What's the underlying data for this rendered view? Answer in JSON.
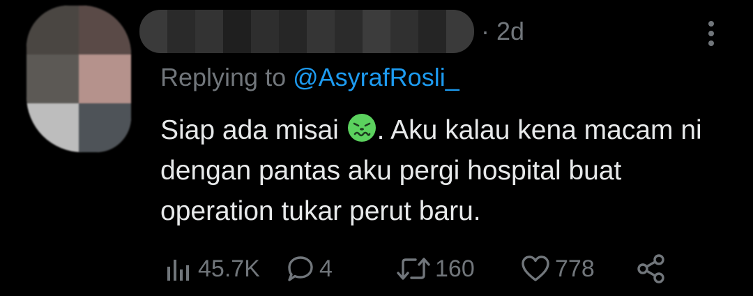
{
  "tweet": {
    "timestamp": "· 2d",
    "replying_prefix": "Replying to ",
    "replying_handle": "@AsyrafRosli_",
    "text_part1": "Siap ada misai ",
    "emoji": "nauseated-face",
    "text_part2": ". Aku kalau kena macam ni dengan pantas aku pergi hospital buat operation tukar perut baru."
  },
  "metrics": {
    "views": "45.7K",
    "replies": "4",
    "retweets": "160",
    "likes": "778"
  },
  "icons": {
    "views": "bar-chart-icon",
    "reply": "speech-bubble-icon",
    "retweet": "retweet-icon",
    "like": "heart-icon",
    "share": "share-icon",
    "more": "more-vertical-icon"
  },
  "colors": {
    "background": "#000000",
    "text": "#e7e9ea",
    "muted": "#71767b",
    "link": "#1d9bf0",
    "emoji": "#5bd15e"
  }
}
